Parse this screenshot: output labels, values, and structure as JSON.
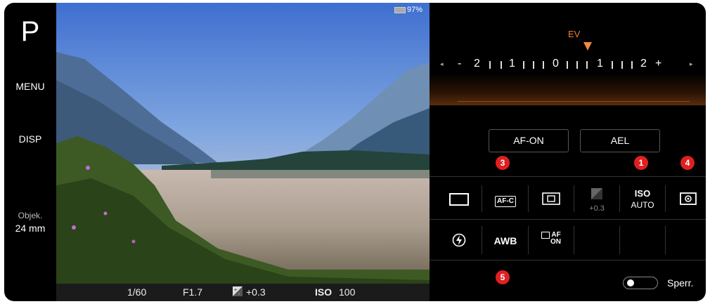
{
  "left_rail": {
    "mode": "P",
    "menu_label": "MENU",
    "disp_label": "DISP",
    "lens_label": "Objek.",
    "focal_length": "24 mm"
  },
  "viewfinder": {
    "battery": "97%"
  },
  "status_bar": {
    "shutter": "1/60",
    "aperture": "F1.7",
    "exposure_comp": "+0.3",
    "iso_label": "ISO",
    "iso_value": "100"
  },
  "ev_dial": {
    "label": "EV",
    "scale": [
      "-",
      "2",
      "1",
      "1",
      "0",
      "1",
      "1",
      "2",
      "+"
    ],
    "value": 0.3
  },
  "buttons": {
    "af_on": "AF-ON",
    "ael": "AEL"
  },
  "badges": [
    "3",
    "1",
    "4",
    "5"
  ],
  "grid_row1": {
    "drive_icon": "single-shot-rectangle-icon",
    "focus_mode": "AF-C",
    "focus_area_icon": "focus-area-icon",
    "ev_icon": "exposure-comp-icon",
    "ev_value": "+0.3",
    "iso_label": "ISO",
    "iso_value": "AUTO",
    "metering_icon": "metering-icon"
  },
  "grid_row2": {
    "flash_icon": "flash-icon",
    "wb": "AWB",
    "face_af_icon": "face-af-on-icon",
    "face_af_text": "AF",
    "face_af_on": "ON"
  },
  "lock": {
    "label": "Sperr."
  },
  "colors": {
    "accent": "#f07a30",
    "badge": "#e02020"
  }
}
